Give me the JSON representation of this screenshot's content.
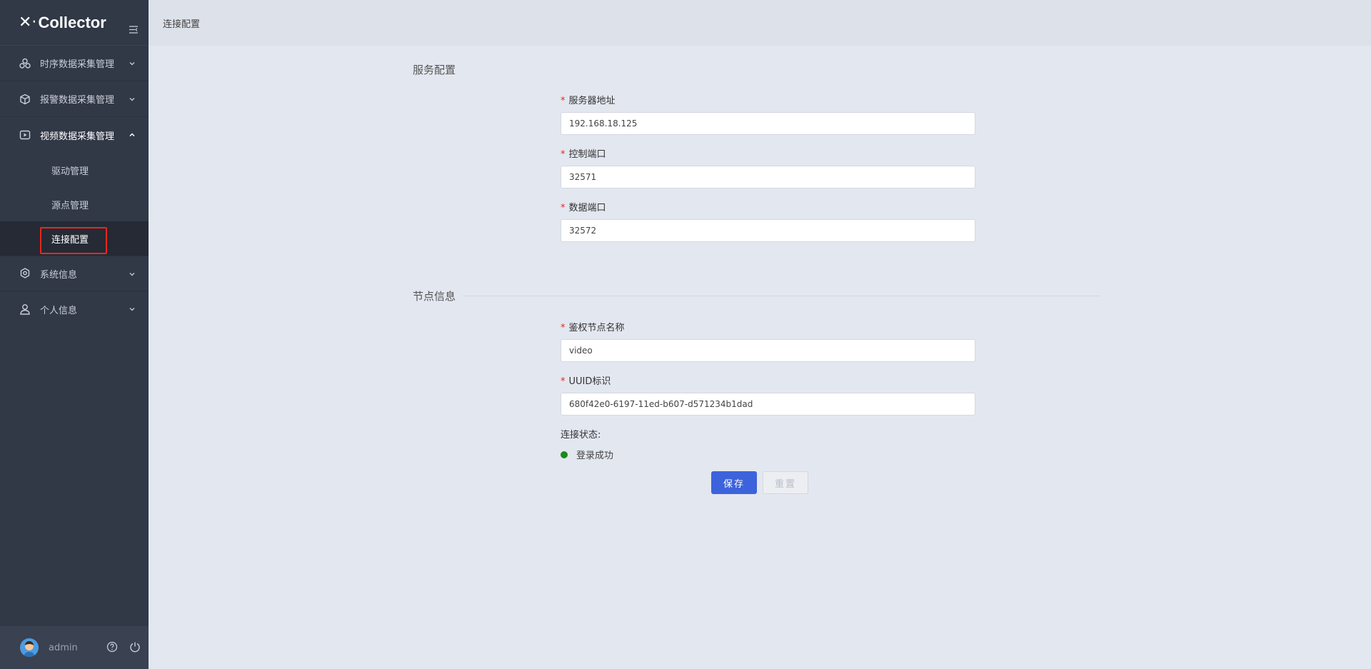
{
  "app": {
    "logo_mark": "✕·",
    "logo_text": "Collector"
  },
  "sidebar": {
    "menus": [
      {
        "label": "时序数据采集管理",
        "icon": "cluster-icon"
      },
      {
        "label": "报警数据采集管理",
        "icon": "box-icon"
      },
      {
        "label": "视频数据采集管理",
        "icon": "video-icon"
      },
      {
        "label": "系统信息",
        "icon": "gear-icon"
      },
      {
        "label": "个人信息",
        "icon": "user-icon"
      }
    ],
    "video_sub": [
      {
        "label": "驱动管理"
      },
      {
        "label": "源点管理"
      },
      {
        "label": "连接配置"
      }
    ],
    "footer": {
      "username": "admin"
    }
  },
  "header": {
    "breadcrumb": "连接配置"
  },
  "server_section": {
    "title": "服务配置",
    "fields": [
      {
        "label": "服务器地址",
        "value": "192.168.18.125"
      },
      {
        "label": "控制端口",
        "value": "32571"
      },
      {
        "label": "数据端口",
        "value": "32572"
      }
    ]
  },
  "node_section": {
    "title": "节点信息",
    "fields": [
      {
        "label": "鉴权节点名称",
        "value": "video"
      },
      {
        "label": "UUID标识",
        "value": "680f42e0-6197-11ed-b607-d571234b1dad"
      }
    ],
    "status_label": "连接状态:",
    "status_value": "登录成功",
    "status_color": "#1a8a1a"
  },
  "buttons": {
    "save": "保存",
    "reset": "重置"
  },
  "colors": {
    "sidebar_bg": "#313846",
    "primary": "#3d63dc",
    "required": "#e8281c"
  }
}
